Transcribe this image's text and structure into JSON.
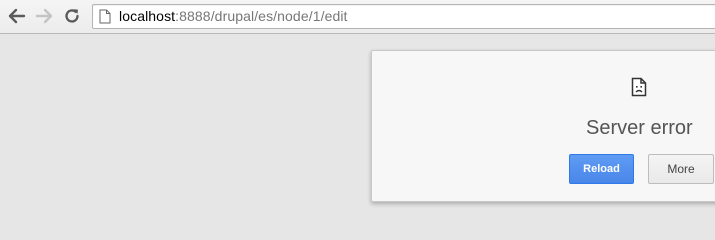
{
  "browser": {
    "url_host": "localhost",
    "url_rest": ":8888/drupal/es/node/1/edit"
  },
  "error": {
    "title": "Server error",
    "reload_label": "Reload",
    "more_label": "More"
  },
  "colors": {
    "accent": "#4a86e8",
    "background": "#e6e6e6"
  },
  "icons": [
    "back-arrow-icon",
    "forward-arrow-icon",
    "reload-icon",
    "page-icon",
    "sad-page-icon"
  ]
}
